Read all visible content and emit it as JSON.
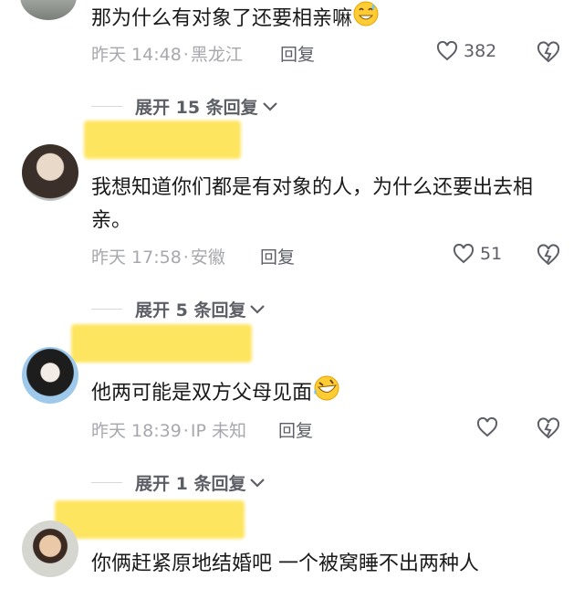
{
  "comments": [
    {
      "text": "那为什么有对象了还要相亲嘛",
      "time": "昨天 14:48",
      "location": "黑龙江",
      "reply_label": "回复",
      "likes": "382",
      "expand_label": "展开 15 条回复"
    },
    {
      "text": "我想知道你们都是有对象的人，为什么还要出去相亲。",
      "time": "昨天 17:58",
      "location": "安徽",
      "reply_label": "回复",
      "likes": "51",
      "expand_label": "展开 5 条回复"
    },
    {
      "text": "他两可能是双方父母见面",
      "time": "昨天 18:39",
      "location": "IP 未知",
      "reply_label": "回复",
      "likes": "",
      "expand_label": "展开 1 条回复"
    },
    {
      "text": "你俩赶紧原地结婚吧 一个被窝睡不出两种人"
    }
  ],
  "separator": "·",
  "icons": {
    "like": "heart-outline-icon",
    "dislike": "broken-heart-icon",
    "expand": "chevron-down-icon",
    "emoji_1": "grinning-sweat-emoji",
    "emoji_2": "rolling-laughing-emoji"
  },
  "colors": {
    "name_redaction": "#fde560",
    "meta": "#a7a8ad",
    "action": "#5d5f66"
  }
}
